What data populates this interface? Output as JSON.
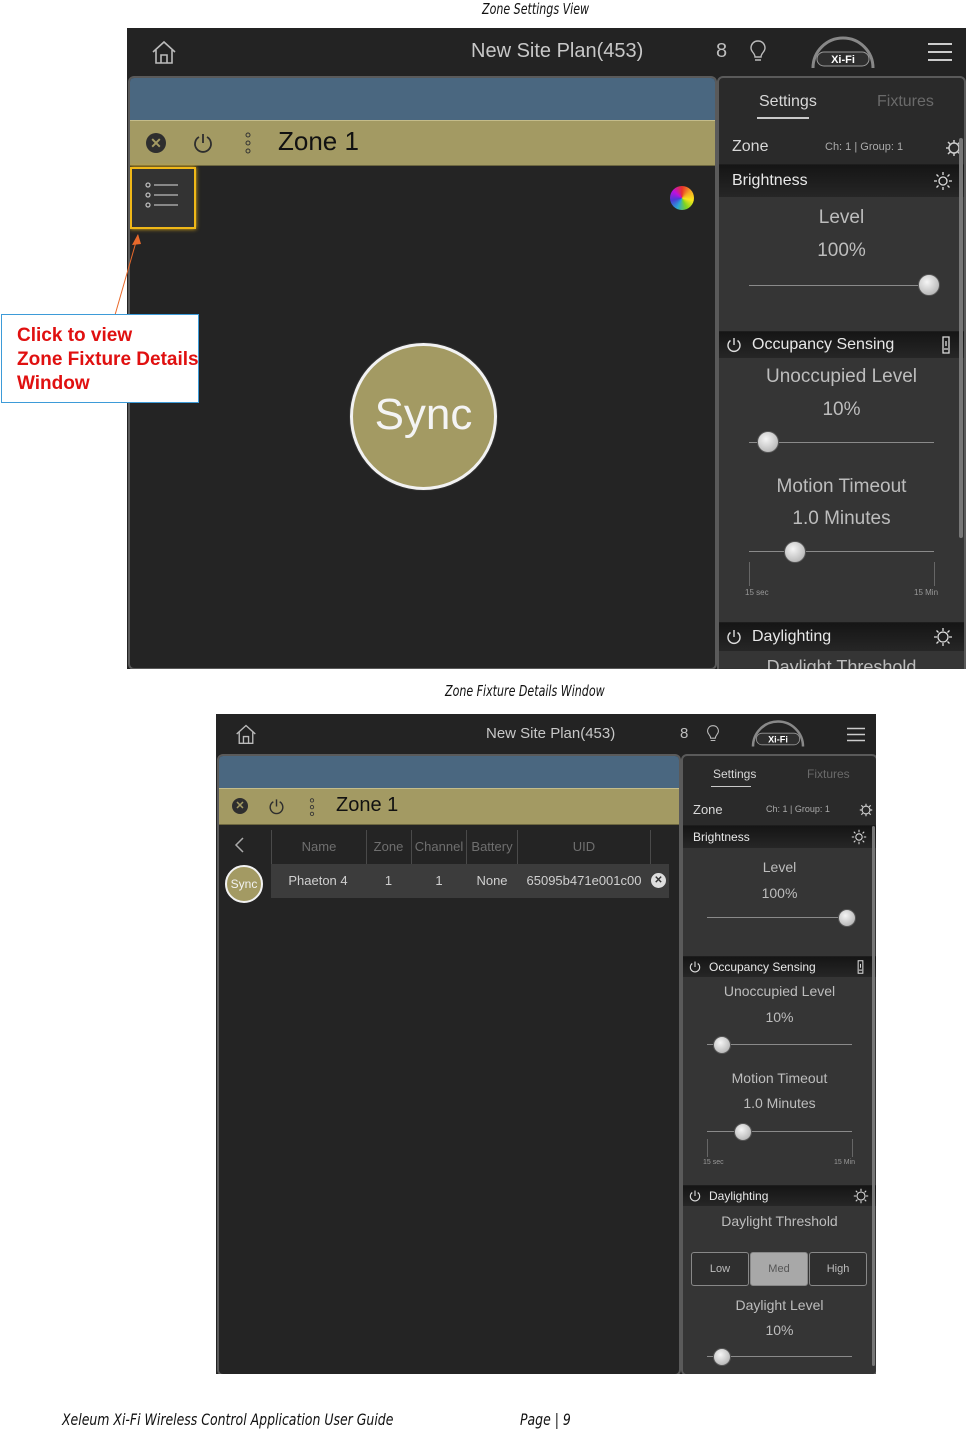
{
  "captions": {
    "top": "Zone Settings View",
    "bottom": "Zone Fixture Details Window"
  },
  "footer": {
    "left": "Xeleum Xi-Fi Wireless Control Application User Guide",
    "right": "Page | 9"
  },
  "app": {
    "title": "New Site Plan(453)",
    "count": "8",
    "logo_text": "Xi-Fi",
    "zone_name": "Zone 1",
    "sync_label": "Sync",
    "tabs": [
      "Settings",
      "Fixtures"
    ],
    "zone_header": {
      "label": "Zone",
      "channel_group": "Ch: 1 | Group: 1"
    },
    "brightness": {
      "title": "Brightness",
      "level_label": "Level",
      "level_value": "100%",
      "level_fraction": 1.0
    },
    "occupancy": {
      "title": "Occupancy Sensing",
      "unoccupied_label": "Unoccupied Level",
      "unoccupied_value": "10%",
      "unoccupied_fraction": 0.1,
      "timeout_label": "Motion Timeout",
      "timeout_value": "1.0 Minutes",
      "timeout_fraction": 0.25,
      "timeout_min": "15 sec",
      "timeout_max": "15 Min"
    },
    "daylighting": {
      "title": "Daylighting",
      "threshold_label": "Daylight Threshold",
      "threshold_options": [
        "Low",
        "Med",
        "High"
      ],
      "threshold_selected": "Med",
      "level_label": "Daylight Level",
      "level_value": "10%",
      "level_fraction": 0.1
    }
  },
  "callout": {
    "lines": [
      "Click to view",
      "Zone Fixture Details",
      "Window"
    ],
    "color": "#e01010"
  },
  "fixtures_table": {
    "columns": [
      "Name",
      "Zone",
      "Channel",
      "Battery",
      "UID"
    ],
    "rows": [
      {
        "name": "Phaeton 4",
        "zone": "1",
        "channel": "1",
        "battery": "None",
        "uid": "65095b471e001c00"
      }
    ]
  },
  "colors": {
    "accent_olive": "#a39a63",
    "blue_header": "#4a6780",
    "highlight": "#f0b818"
  }
}
